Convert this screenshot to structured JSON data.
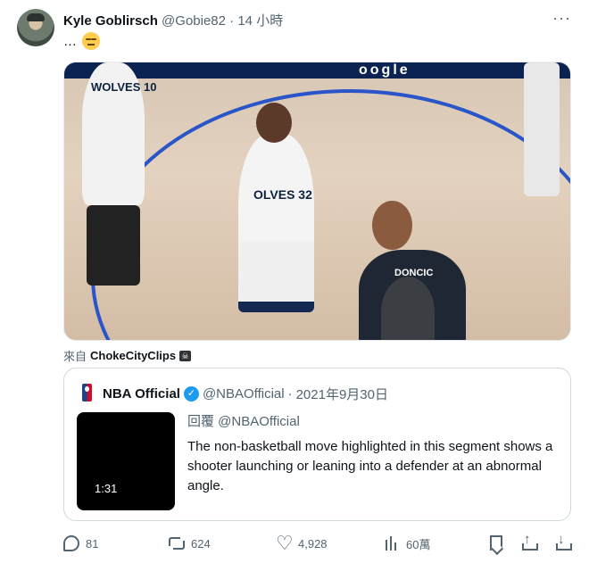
{
  "tweet": {
    "author_name": "Kyle Goblirsch",
    "author_handle": "@Gobie82",
    "separator": "·",
    "time": "14 小時",
    "more": "···",
    "text": "…",
    "emoji": "expressionless-face"
  },
  "media": {
    "banner_text": "oogle",
    "jersey_left": "WOLVES 10",
    "jersey_center": "OLVES 32",
    "jersey_right": "DONCIC"
  },
  "via": {
    "label": "來自",
    "source": "ChokeCityClips"
  },
  "quote": {
    "name": "NBA Official",
    "handle": "@NBAOfficial",
    "separator": "·",
    "date": "2021年9月30日",
    "reply_to": "回覆 @NBAOfficial",
    "body": "The non-basketball move highlighted in this segment shows a shooter launching or leaning into a defender at an abnormal angle.",
    "video_duration": "1:31",
    "verified": true
  },
  "actions": {
    "replies": "81",
    "retweets": "624",
    "likes": "4,928",
    "views": "60萬"
  },
  "colors": {
    "text_primary": "#0f1419",
    "text_secondary": "#536471",
    "verified_blue": "#1d9bf0",
    "border": "#cfd9de"
  }
}
